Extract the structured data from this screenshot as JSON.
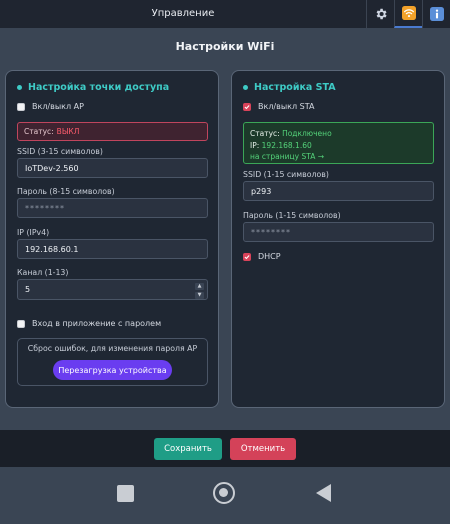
{
  "header": {
    "title": "Управление",
    "icons": [
      "gear-icon",
      "wifi-icon",
      "info-icon"
    ]
  },
  "page_title": "Настройки WiFi",
  "ap": {
    "title": "Настройка точки доступа",
    "enable_label": "Вкл/выкл AP",
    "enabled": false,
    "status_label": "Статус:",
    "status_value": "ВЫКЛ",
    "ssid_label": "SSID (3-15 символов)",
    "ssid_value": "IoTDev-2.560",
    "password_label": "Пароль (8-15 символов)",
    "password_value": "********",
    "ip_label": "IP (IPv4)",
    "ip_value": "192.168.60.1",
    "channel_label": "Канал (1-13)",
    "channel_value": "5",
    "login_label": "Вход в приложение с паролем",
    "login_enabled": false,
    "reset_text": "Сброс ошибок, для изменения пароля AP",
    "reboot_label": "Перезагрузка устройства"
  },
  "sta": {
    "title": "Настройка STA",
    "enable_label": "Вкл/выкл STA",
    "enabled": true,
    "status_label": "Статус:",
    "status_value": "Подключено",
    "ip_label": "IP:",
    "ip_value": "192.168.1.60",
    "link_label": "на страницу STA →",
    "ssid_label": "SSID (1-15 символов)",
    "ssid_value": "p293",
    "password_label": "Пароль (1-15 символов)",
    "password_value": "********",
    "dhcp_label": "DHCP",
    "dhcp_enabled": true
  },
  "footer": {
    "save_label": "Сохранить",
    "cancel_label": "Отменить"
  },
  "colors": {
    "accent": "#3ecbc6",
    "save": "#1f9d86",
    "cancel": "#d44259",
    "reboot": "#6a3df0",
    "status_off": "#ff5c6c",
    "status_on": "#54d37a"
  }
}
